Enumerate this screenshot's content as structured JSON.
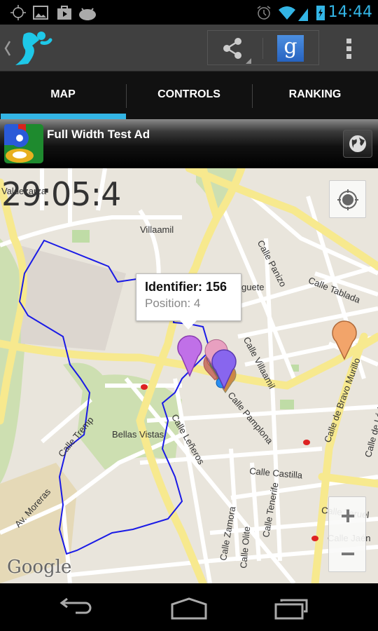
{
  "status_bar": {
    "time": "14:44",
    "left_icons": [
      "gps-icon",
      "gallery-icon",
      "play-store-icon",
      "android-icon"
    ],
    "right_icons": [
      "alarm-icon",
      "wifi-icon",
      "signal-icon",
      "battery-charging-icon"
    ],
    "accent_color": "#33b5e5"
  },
  "action_bar": {
    "app_icon": "runner-icon",
    "actions": [
      "share-icon",
      "google-plus-icon",
      "overflow-menu-icon"
    ]
  },
  "tabs": [
    {
      "label": "MAP",
      "selected": true
    },
    {
      "label": "CONTROLS",
      "selected": false
    },
    {
      "label": "RANKING",
      "selected": false
    }
  ],
  "ad": {
    "title": "Full Width Test Ad",
    "icon": "google-logo-icon",
    "action_icon": "globe-icon"
  },
  "map": {
    "timer": "29:05:4",
    "info_window": {
      "identifier": "Identifier: 156",
      "position": "Position: 4"
    },
    "labels": [
      "Valdezarza",
      "Villaamil",
      "Calle Panizo",
      "Calle Tablada",
      "guete",
      "Calle Villaamil",
      "Calle Pamplona",
      "Calle de Bravo Murillo",
      "Calle de Lérida",
      "Bellas Vistas",
      "Calle Tremp",
      "Calle Leñeros",
      "Av. Moreras",
      "Calle Castilla",
      "Calle Tenerife",
      "Calle Zamora",
      "Calle Olite",
      "Calle Teruel",
      "Calle Jaén"
    ],
    "attribution": "Google",
    "controls": {
      "my_location": "my-location-icon",
      "zoom_in": "+",
      "zoom_out": "−"
    }
  },
  "nav_bar": [
    "back-icon",
    "home-icon",
    "recents-icon"
  ]
}
